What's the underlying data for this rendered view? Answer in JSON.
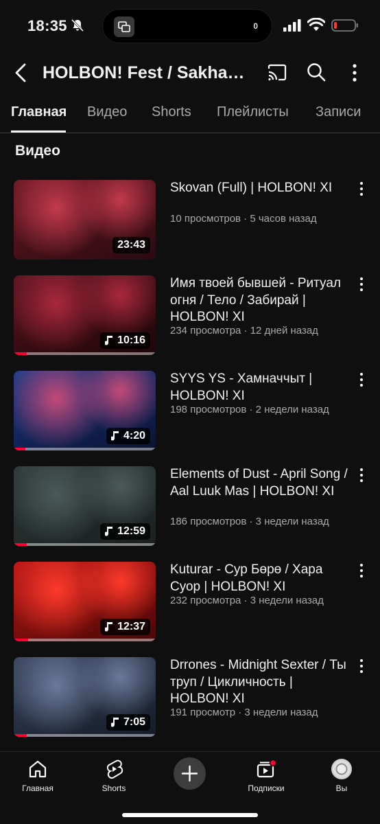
{
  "status_bar": {
    "time": "18:35",
    "island_count": "0",
    "icons": [
      "bell-muted-icon",
      "screen-mirror-icon",
      "signal-icon",
      "wifi-icon",
      "battery-low-icon"
    ]
  },
  "header": {
    "title": "HOLBON! Fest / Sakha Rock Festival",
    "icons": [
      "back-icon",
      "cast-icon",
      "search-icon",
      "more-vertical-icon"
    ]
  },
  "tabs": [
    {
      "label": "Главная",
      "active": true
    },
    {
      "label": "Видео",
      "active": false
    },
    {
      "label": "Shorts",
      "active": false
    },
    {
      "label": "Плейлисты",
      "active": false
    },
    {
      "label": "Записи",
      "active": false
    }
  ],
  "section_title": "Видео",
  "videos": [
    {
      "title": "Skovan (Full) | HOLBON! XI",
      "meta": "10 просмотров · 5 часов назад",
      "duration": "23:43",
      "music": false,
      "progress": 0,
      "colors": [
        "#6b1a24",
        "#c23a4a",
        "#2a0a10"
      ]
    },
    {
      "title": "Имя твоей бывшей - Ритуал огня / Тело / Забирай | HOLBON! XI",
      "meta": "234 просмотра · 12 дней назад",
      "duration": "10:16",
      "music": true,
      "progress": 0.09,
      "colors": [
        "#5a1620",
        "#a8283a",
        "#1c0508"
      ]
    },
    {
      "title": "SYYS YS - Хамначчыт | HOLBON! XI",
      "meta": "198 просмотров · 2 недели назад",
      "duration": "4:20",
      "music": true,
      "progress": 0.08,
      "colors": [
        "#1b3d8a",
        "#c24a7a",
        "#0a1230"
      ]
    },
    {
      "title": "Elements of Dust - April Song / Aal Luuk Mas | HOLBON! XI",
      "meta": "186 просмотров · 3 недели назад",
      "duration": "12:59",
      "music": true,
      "progress": 0.09,
      "colors": [
        "#2f3a3a",
        "#4c5a5a",
        "#1a1f1f"
      ]
    },
    {
      "title": "Kuturar - Сур Бөрө / Хара Суор | HOLBON! XI",
      "meta": "232 просмотра · 3 недели назад",
      "duration": "12:37",
      "music": true,
      "progress": 0.1,
      "colors": [
        "#b81818",
        "#ff3a2a",
        "#4a0606"
      ]
    },
    {
      "title": "Drrones - Midnight Sexter / Ты труп / Цикличность | HOLBON! XI",
      "meta": "191 просмотр · 3 недели назад",
      "duration": "7:05",
      "music": true,
      "progress": 0.09,
      "colors": [
        "#3a4660",
        "#6a7a98",
        "#141a28"
      ]
    }
  ],
  "bottom_nav": [
    {
      "label": "Главная",
      "icon": "home-icon"
    },
    {
      "label": "Shorts",
      "icon": "shorts-icon"
    },
    {
      "label": "",
      "icon": "create-plus-icon"
    },
    {
      "label": "Подписки",
      "icon": "subscriptions-icon"
    },
    {
      "label": "Вы",
      "icon": "avatar-icon"
    }
  ],
  "accent_color": "#ff0033"
}
